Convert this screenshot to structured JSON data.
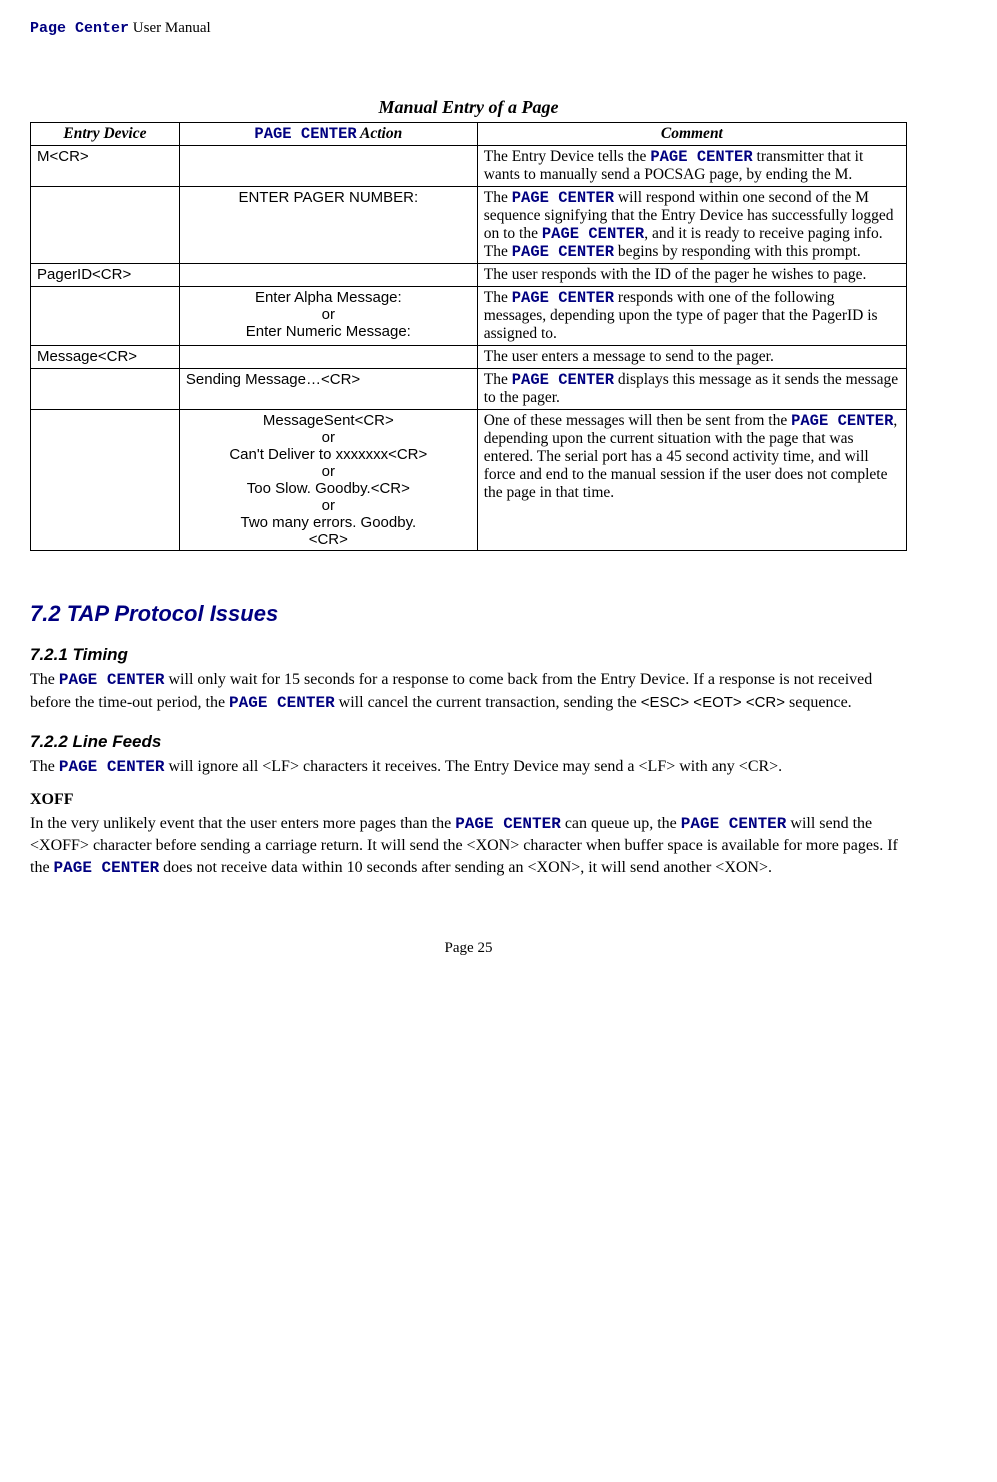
{
  "header": {
    "product": "Page Center",
    "suffix": " User Manual"
  },
  "table": {
    "caption": "Manual Entry of a Page",
    "headers": {
      "entry": "Entry Device",
      "action_prefix": "PAGE CENTER",
      "action_suffix": " Action",
      "comment": "Comment"
    },
    "rows": {
      "r1": {
        "entry": "M<CR>",
        "action": "",
        "c_pre": "The Entry Device tells the ",
        "c_pc": "PAGE CENTER",
        "c_post": " transmitter that it wants to manually send a POCSAG page, by ending the M."
      },
      "r2": {
        "entry": "",
        "action": "ENTER PAGER NUMBER:",
        "c1": "The ",
        "pc1": "PAGE CENTER",
        "c2": " will respond within one second of the M sequence signifying that the Entry Device has successfully logged on to the ",
        "pc2": "PAGE CENTER",
        "c3": ", and it is ready to receive paging info.  The ",
        "pc3": "PAGE CENTER",
        "c4": " begins by responding with this prompt."
      },
      "r3": {
        "entry": "PagerID<CR>",
        "action": "",
        "comment": "The user responds with the ID of the pager he wishes to page."
      },
      "r4": {
        "entry": "",
        "a1": "Enter Alpha Message:",
        "a2": "or",
        "a3": "Enter Numeric Message:",
        "c1": "The ",
        "pc1": "PAGE CENTER",
        "c2": " responds with one of the following messages, depending upon the type of pager that the PagerID is assigned to."
      },
      "r5": {
        "entry": "Message<CR>",
        "action": "",
        "comment": "The user enters a message to send to the pager."
      },
      "r6": {
        "entry": "",
        "action": "Sending Message…<CR>",
        "c1": "The ",
        "pc1": "PAGE CENTER",
        "c2": " displays this message as it sends the message to the pager."
      },
      "r7": {
        "entry": "",
        "a1": "MessageSent<CR>",
        "a2": "or",
        "a3": "Can't Deliver to xxxxxxx<CR>",
        "a4": "or",
        "a5": "Too Slow. Goodby.<CR>",
        "a6": "or",
        "a7": "Two many errors. Goodby.",
        "a8": "<CR>",
        "c1": "One of these messages will then be sent from the ",
        "pc1": "PAGE CENTER",
        "c2": ", depending upon the current situation with the page that was entered.  The serial port has a 45 second activity time, and will force and end to the manual session if the user does not complete the page in that time."
      }
    }
  },
  "section72": {
    "title": "7.2    TAP Protocol Issues"
  },
  "s721": {
    "title": "7.2.1     Timing",
    "t1": "The ",
    "pc1": "PAGE CENTER",
    "t2": " will only wait for 15 seconds for a response to come back from the Entry Device. If a response is not received before the time-out period, the ",
    "pc2": "PAGE CENTER",
    "t3": " will cancel the current transaction, sending the ",
    "esc": "<ESC> <EOT> <CR>",
    "t4": " sequence."
  },
  "s722": {
    "title": "7.2.2     Line Feeds",
    "t1": "The ",
    "pc1": "PAGE CENTER",
    "t2": " will ignore all <LF> characters it receives.  The Entry Device may send a <LF> with any <CR>."
  },
  "xoff": {
    "head": "XOFF",
    "t1": "In the very unlikely event that the user enters more pages than the ",
    "pc1": "PAGE CENTER",
    "t2": " can queue up, the ",
    "pc2": "PAGE CENTER",
    "t3": " will send the <XOFF> character before sending a carriage return.  It will send the <XON> character when buffer space is available for more pages.  If the ",
    "pc3": "PAGE CENTER",
    "t4": " does not receive data within 10 seconds after sending an <XON>, it will send another <XON>."
  },
  "footer": {
    "page": "Page 25"
  }
}
